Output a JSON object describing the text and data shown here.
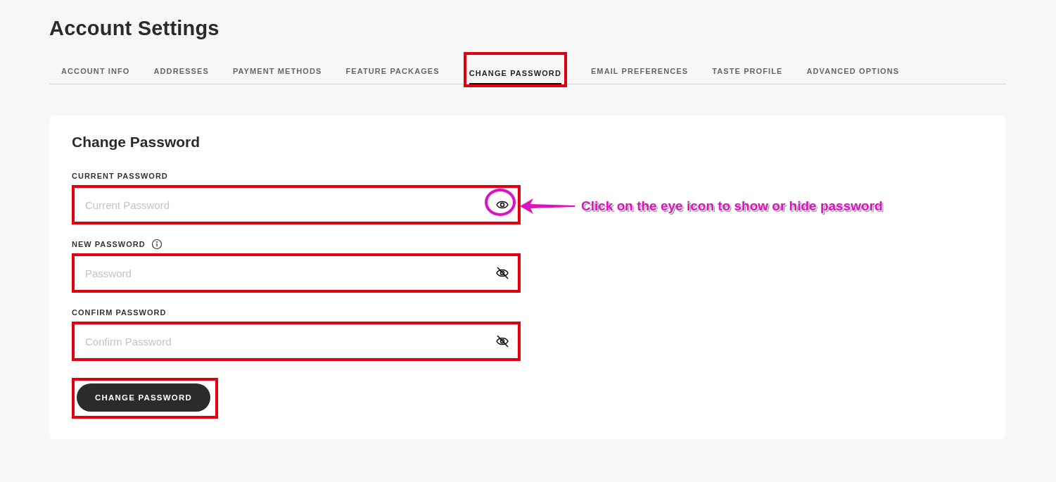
{
  "page": {
    "title": "Account Settings"
  },
  "tabs": [
    {
      "label": "ACCOUNT INFO",
      "selected": false,
      "highlighted": false
    },
    {
      "label": "ADDRESSES",
      "selected": false,
      "highlighted": false
    },
    {
      "label": "PAYMENT METHODS",
      "selected": false,
      "highlighted": false
    },
    {
      "label": "FEATURE PACKAGES",
      "selected": false,
      "highlighted": false
    },
    {
      "label": "CHANGE PASSWORD",
      "selected": true,
      "highlighted": true
    },
    {
      "label": "EMAIL PREFERENCES",
      "selected": false,
      "highlighted": false
    },
    {
      "label": "TASTE PROFILE",
      "selected": false,
      "highlighted": false
    },
    {
      "label": "ADVANCED OPTIONS",
      "selected": false,
      "highlighted": false
    }
  ],
  "form": {
    "heading": "Change Password",
    "fields": [
      {
        "label": "CURRENT PASSWORD",
        "info": false,
        "placeholder": "Current Password",
        "password_visible": true,
        "highlighted": true,
        "callout": "Click on the eye icon to show or hide password"
      },
      {
        "label": "NEW PASSWORD",
        "info": true,
        "placeholder": "Password",
        "password_visible": false,
        "highlighted": true
      },
      {
        "label": "CONFIRM PASSWORD",
        "info": false,
        "placeholder": "Confirm Password",
        "password_visible": false,
        "highlighted": true
      }
    ],
    "submit": {
      "label": "CHANGE PASSWORD",
      "highlighted": true
    }
  }
}
